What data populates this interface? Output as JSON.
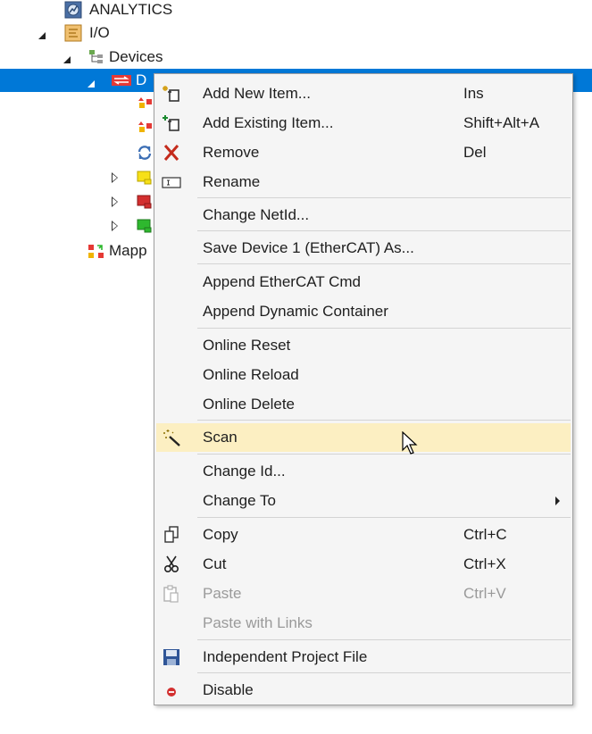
{
  "tree": {
    "analytics_label": "ANALYTICS",
    "io_label": "I/O",
    "devices_label": "Devices",
    "device1_label": "D",
    "mappings_label": "Mapp"
  },
  "menu": {
    "add_new_item": {
      "label": "Add New Item...",
      "shortcut": "Ins"
    },
    "add_existing_item": {
      "label": "Add Existing Item...",
      "shortcut": "Shift+Alt+A"
    },
    "remove": {
      "label": "Remove",
      "shortcut": "Del"
    },
    "rename": {
      "label": "Rename"
    },
    "change_netid": {
      "label": "Change NetId..."
    },
    "save_device_as": {
      "label": "Save Device 1 (EtherCAT) As..."
    },
    "append_ethercat_cmd": {
      "label": "Append EtherCAT Cmd"
    },
    "append_dynamic_container": {
      "label": "Append Dynamic Container"
    },
    "online_reset": {
      "label": "Online Reset"
    },
    "online_reload": {
      "label": "Online Reload"
    },
    "online_delete": {
      "label": "Online Delete"
    },
    "scan": {
      "label": "Scan"
    },
    "change_id": {
      "label": "Change Id..."
    },
    "change_to": {
      "label": "Change To"
    },
    "copy": {
      "label": "Copy",
      "shortcut": "Ctrl+C"
    },
    "cut": {
      "label": "Cut",
      "shortcut": "Ctrl+X"
    },
    "paste": {
      "label": "Paste",
      "shortcut": "Ctrl+V"
    },
    "paste_with_links": {
      "label": "Paste with Links"
    },
    "independent_project_file": {
      "label": "Independent Project File"
    },
    "disable": {
      "label": "Disable"
    }
  },
  "colors": {
    "selection": "#0078d7",
    "hover": "#fcefc2",
    "menu_bg": "#f5f5f5",
    "remove_red": "#c42b1c"
  }
}
